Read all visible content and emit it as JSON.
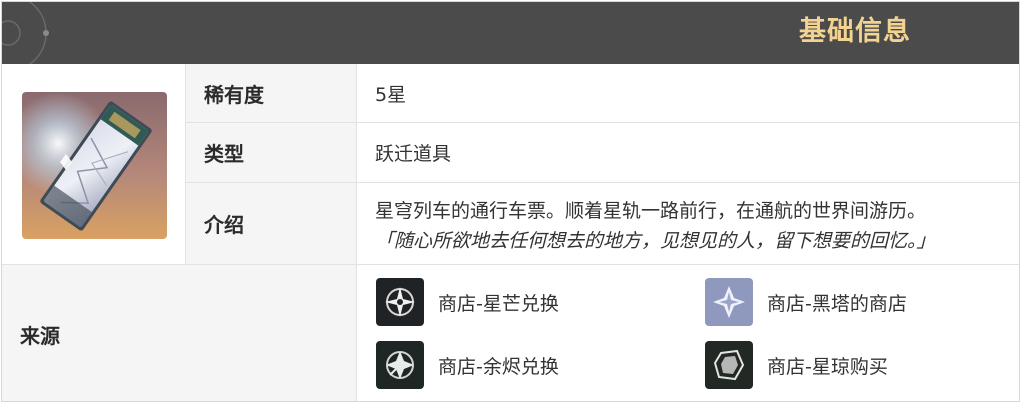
{
  "header": {
    "title": "基础信息"
  },
  "item": {
    "image_icon": "pass-ticket-icon"
  },
  "rows": {
    "rarity": {
      "label": "稀有度",
      "value": "5星"
    },
    "type": {
      "label": "类型",
      "value": "跃迁道具"
    },
    "intro": {
      "label": "介绍",
      "line1": "星穹列车的通行车票。顺着星轨一路前行，在通航的世界间游历。",
      "line2": "「随心所欲地去任何想去的地方，见想见的人，留下想要的回忆。」"
    },
    "source": {
      "label": "来源",
      "items": [
        {
          "text": "商店-星芒兑换",
          "icon": "starlight-exchange-icon"
        },
        {
          "text": "商店-黑塔的商店",
          "icon": "herta-shop-icon"
        },
        {
          "text": "商店-余烬兑换",
          "icon": "embers-exchange-icon"
        },
        {
          "text": "商店-星琼购买",
          "icon": "stellar-jade-icon"
        }
      ]
    }
  }
}
